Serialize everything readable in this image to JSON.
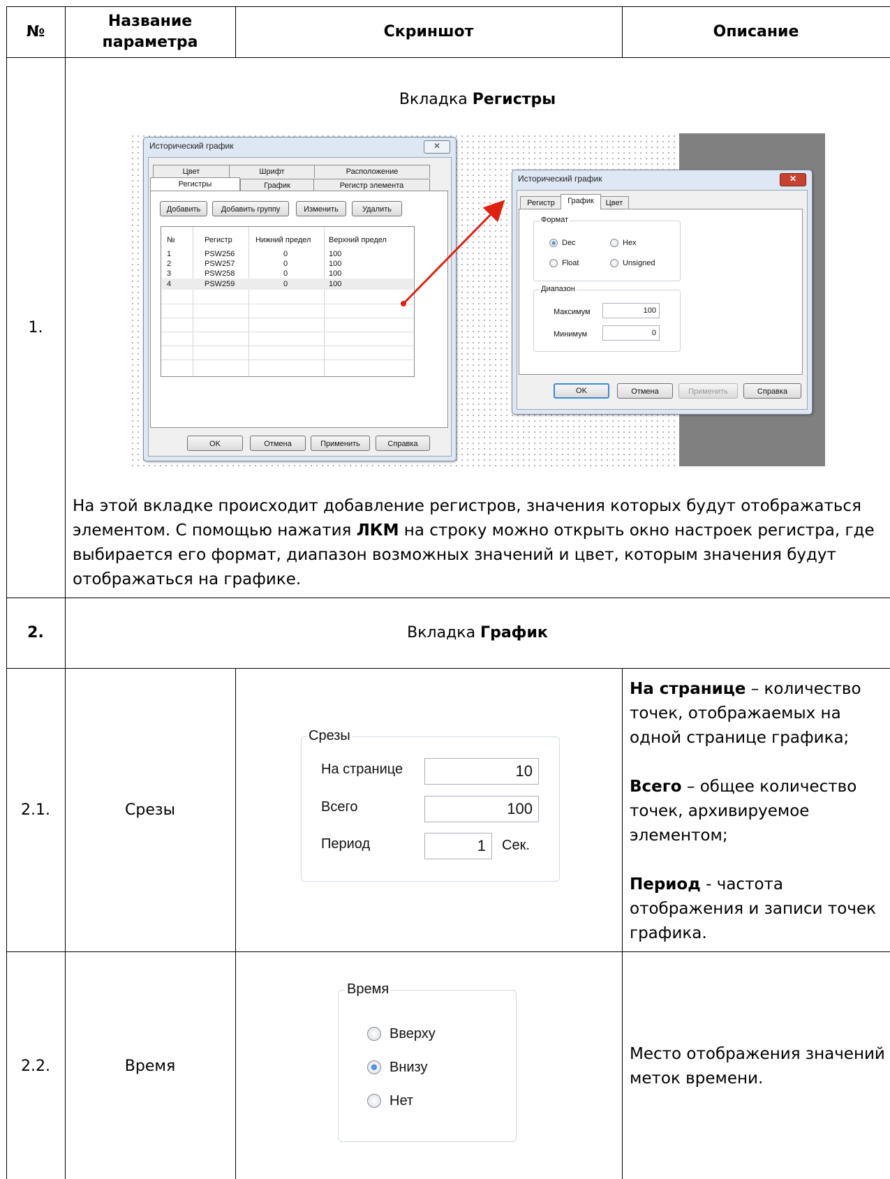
{
  "header": {
    "num": "№",
    "param_line1": "Название",
    "param_line2": "параметра",
    "screenshot": "Скриншот",
    "description": "Описание"
  },
  "row1": {
    "num": "1.",
    "tab_prefix": "Вкладка ",
    "tab_name": "Регистры",
    "desc_part1": "На этой вкладке происходит добавление регистров, значения которых будут отображаться элементом. С помощью нажатия ",
    "desc_bold": "ЛКМ",
    "desc_part2": " на строку можно открыть окно настроек регистра, где выбирается его формат, диапазон возможных значений и цвет, которым значения будут отображаться на графике."
  },
  "dialog1": {
    "title": "Исторический график",
    "close": "✕",
    "tabs_back": [
      "Цвет",
      "Шрифт",
      "Расположение"
    ],
    "tabs_front": [
      "Регистры",
      "График",
      "Регистр элемента"
    ],
    "buttons_top": [
      "Добавить",
      "Добавить группу",
      "Изменить",
      "Удалить"
    ],
    "columns": [
      "№",
      "Регистр",
      "Нижний предел",
      "Верхний предел"
    ],
    "rows": [
      [
        "1",
        "PSW256",
        "0",
        "100"
      ],
      [
        "2",
        "PSW257",
        "0",
        "100"
      ],
      [
        "3",
        "PSW258",
        "0",
        "100"
      ],
      [
        "4",
        "PSW259",
        "0",
        "100"
      ]
    ],
    "buttons_bottom": [
      "OK",
      "Отмена",
      "Применить",
      "Справка"
    ]
  },
  "dialog2": {
    "title": "Исторический график",
    "close": "✕",
    "tabs": [
      "Регистр",
      "График",
      "Цвет"
    ],
    "format_label": "Формат",
    "format_options": [
      "Dec",
      "Hex",
      "Float",
      "Unsigned"
    ],
    "format_selected": "Dec",
    "range_label": "Диапазон",
    "max_label": "Максимум",
    "max_value": "100",
    "min_label": "Минимум",
    "min_value": "0",
    "buttons": [
      "OK",
      "Отмена",
      "Применить",
      "Справка"
    ]
  },
  "row2": {
    "num": "2.",
    "tab_prefix": "Вкладка ",
    "tab_name": "График"
  },
  "row21": {
    "num": "2.1.",
    "name": "Срезы",
    "group_label": "Срезы",
    "fields": [
      {
        "label": "На странице",
        "value": "10"
      },
      {
        "label": "Всего",
        "value": "100"
      },
      {
        "label": "Период",
        "value": "1",
        "unit": "Сек."
      }
    ],
    "desc1_bold": "На странице",
    "desc1": " – количество точек, отображаемых на одной странице графика;",
    "desc2_bold": "Всего",
    "desc2": " – общее количество точек, архивируемое элементом;",
    "desc3_bold": "Период",
    "desc3": " - частота отображения и записи точек графика."
  },
  "row22": {
    "num": "2.2.",
    "name": "Время",
    "group_label": "Время",
    "options": [
      "Вверху",
      "Внизу",
      "Нет"
    ],
    "selected": "Внизу",
    "desc": "Место отображения значений меток времени."
  }
}
